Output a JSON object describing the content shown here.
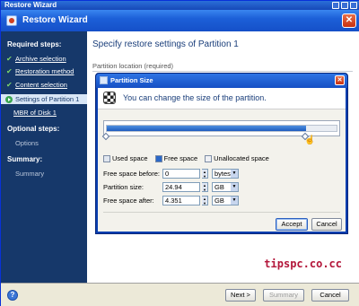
{
  "window": {
    "strip_title": "Restore Wizard",
    "title": "Restore Wizard"
  },
  "sidebar": {
    "required_heading": "Required steps:",
    "steps": [
      {
        "label": "Archive selection",
        "done": true
      },
      {
        "label": "Restoration method",
        "done": true
      },
      {
        "label": "Content selection",
        "done": true
      },
      {
        "label": "Settings of Partition 1",
        "current": true
      },
      {
        "label": "MBR of Disk 1"
      }
    ],
    "optional_heading": "Optional steps:",
    "optional_items": [
      "Options"
    ],
    "summary_heading": "Summary:",
    "summary_items": [
      "Summary"
    ]
  },
  "main": {
    "heading": "Specify restore settings of Partition 1",
    "location_label": "Partition location (required)"
  },
  "dialog": {
    "title": "Partition Size",
    "message": "You can change the size of the partition.",
    "bar": {
      "used_fraction": 0.0,
      "free_fraction": 0.86,
      "unallocated_fraction": 0.14
    },
    "legend": {
      "used": "Used space",
      "free": "Free space",
      "unallocated": "Unallocated space"
    },
    "fields": {
      "free_before_label": "Free space before:",
      "free_before_value": "0",
      "free_before_unit": "bytes",
      "size_label": "Partition size:",
      "size_value": "24.94",
      "size_unit": "GB",
      "free_after_label": "Free space after:",
      "free_after_value": "4.351",
      "free_after_unit": "GB"
    },
    "accept_label": "Accept",
    "cancel_label": "Cancel"
  },
  "bottom": {
    "next_label": "Next >",
    "summary_label": "Summary",
    "cancel_label": "Cancel"
  },
  "watermark": "tipspc.co.cc",
  "colors": {
    "sidebar": "#16386a",
    "accent": "#1e5cbf",
    "watermark": "#b3163a"
  }
}
